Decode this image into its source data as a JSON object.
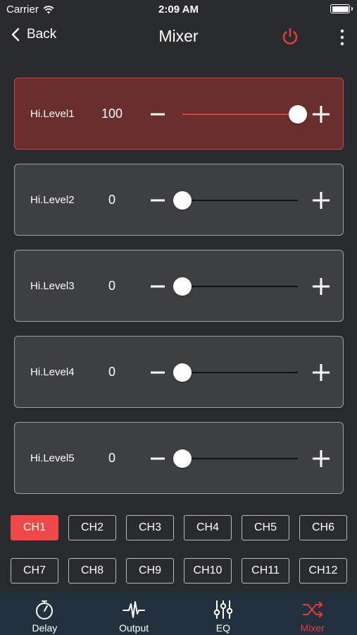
{
  "status_bar": {
    "carrier": "Carrier",
    "time": "2:09 AM"
  },
  "nav": {
    "back_label": "Back",
    "title": "Mixer"
  },
  "accent_color": "#e53a3a",
  "channels": [
    {
      "label": "Hi.Level1",
      "value": "100",
      "level_fraction": 1.0,
      "active": true
    },
    {
      "label": "Hi.Level2",
      "value": "0",
      "level_fraction": 0.0,
      "active": false
    },
    {
      "label": "Hi.Level3",
      "value": "0",
      "level_fraction": 0.0,
      "active": false
    },
    {
      "label": "Hi.Level4",
      "value": "0",
      "level_fraction": 0.0,
      "active": false
    },
    {
      "label": "Hi.Level5",
      "value": "0",
      "level_fraction": 0.0,
      "active": false
    }
  ],
  "ch_buttons": [
    "CH1",
    "CH2",
    "CH3",
    "CH4",
    "CH5",
    "CH6",
    "CH7",
    "CH8",
    "CH9",
    "CH10",
    "CH11",
    "CH12"
  ],
  "selected_ch": "CH1",
  "tabs": [
    {
      "label": "Delay",
      "icon": "stopwatch-icon"
    },
    {
      "label": "Output",
      "icon": "waveform-icon"
    },
    {
      "label": "EQ",
      "icon": "sliders-icon"
    },
    {
      "label": "Mixer",
      "icon": "shuffle-icon"
    }
  ],
  "selected_tab": "Mixer"
}
